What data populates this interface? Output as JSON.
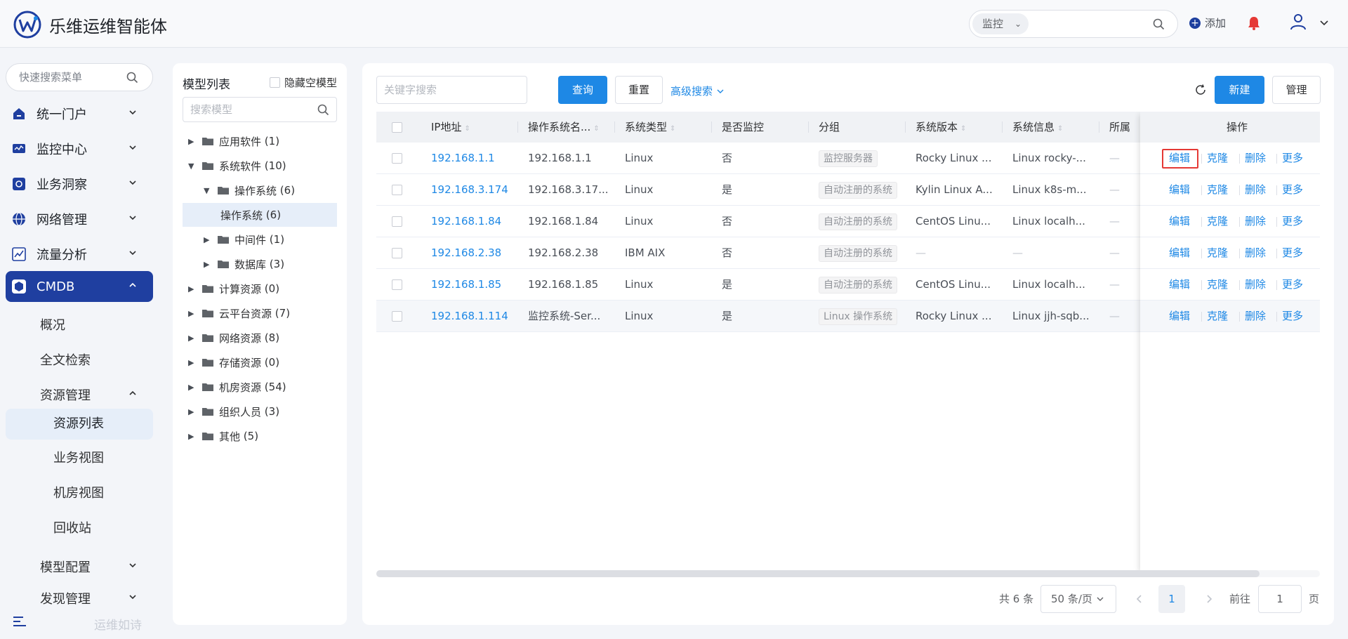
{
  "header": {
    "app_title": "乐维运维智能体",
    "search_scope": "监控",
    "add_label": "添加"
  },
  "nav": {
    "search_placeholder": "快速搜索菜单",
    "items": [
      {
        "label": "统一门户",
        "icon": "home-icon"
      },
      {
        "label": "监控中心",
        "icon": "monitor-icon"
      },
      {
        "label": "业务洞察",
        "icon": "insight-icon"
      },
      {
        "label": "网络管理",
        "icon": "globe-icon"
      },
      {
        "label": "流量分析",
        "icon": "chart-icon"
      },
      {
        "label": "CMDB",
        "icon": "cube-icon"
      }
    ],
    "cmdb_children": {
      "overview": "概况",
      "fulltext": "全文检索",
      "resource_mgmt": "资源管理",
      "resource_list": "资源列表",
      "business_view": "业务视图",
      "room_view": "机房视图",
      "recycle": "回收站",
      "model_config": "模型配置",
      "discovery": "发现管理"
    },
    "slogan": "运维如诗"
  },
  "model_tree": {
    "title": "模型列表",
    "hide_empty_label": "隐藏空模型",
    "search_placeholder": "搜索模型",
    "nodes": [
      {
        "label": "应用软件",
        "count": "(1)"
      },
      {
        "label": "系统软件",
        "count": "(10)"
      },
      {
        "label": "操作系统",
        "count": "(6)"
      },
      {
        "label": "操作系统",
        "count": "(6)"
      },
      {
        "label": "中间件",
        "count": "(1)"
      },
      {
        "label": "数据库",
        "count": "(3)"
      },
      {
        "label": "计算资源",
        "count": "(0)"
      },
      {
        "label": "云平台资源",
        "count": "(7)"
      },
      {
        "label": "网络资源",
        "count": "(8)"
      },
      {
        "label": "存储资源",
        "count": "(0)"
      },
      {
        "label": "机房资源",
        "count": "(54)"
      },
      {
        "label": "组织人员",
        "count": "(3)"
      },
      {
        "label": "其他",
        "count": "(5)"
      }
    ]
  },
  "toolbar": {
    "keyword_placeholder": "关键字搜索",
    "query": "查询",
    "reset": "重置",
    "advanced": "高级搜索",
    "new": "新建",
    "manage": "管理"
  },
  "table": {
    "columns": [
      "IP地址",
      "操作系统名...",
      "系统类型",
      "是否监控",
      "分组",
      "系统版本",
      "系统信息",
      "所属",
      "操作"
    ],
    "rows": [
      {
        "ip": "192.168.1.1",
        "os_name": "192.168.1.1",
        "type": "Linux",
        "monitored": "否",
        "group": "监控服务器",
        "version": "Rocky Linux ...",
        "info": "Linux rocky-...",
        "owner": "—"
      },
      {
        "ip": "192.168.3.174",
        "os_name": "192.168.3.17...",
        "type": "Linux",
        "monitored": "是",
        "group": "自动注册的系统",
        "version": "Kylin Linux A...",
        "info": "Linux k8s-m...",
        "owner": "—"
      },
      {
        "ip": "192.168.1.84",
        "os_name": "192.168.1.84",
        "type": "Linux",
        "monitored": "否",
        "group": "自动注册的系统",
        "version": "CentOS Linu...",
        "info": "Linux localh...",
        "owner": "—"
      },
      {
        "ip": "192.168.2.38",
        "os_name": "192.168.2.38",
        "type": "IBM AIX",
        "monitored": "否",
        "group": "自动注册的系统",
        "version": "—",
        "info": "—",
        "owner": "—"
      },
      {
        "ip": "192.168.1.85",
        "os_name": "192.168.1.85",
        "type": "Linux",
        "monitored": "是",
        "group": "自动注册的系统",
        "version": "CentOS Linu...",
        "info": "Linux localh...",
        "owner": "—"
      },
      {
        "ip": "192.168.1.114",
        "os_name": "监控系统-Ser...",
        "type": "Linux",
        "monitored": "是",
        "group": "Linux 操作系统",
        "version": "Rocky Linux ...",
        "info": "Linux jjh-sqb...",
        "owner": "—"
      }
    ],
    "actions": {
      "edit": "编辑",
      "clone": "克隆",
      "delete": "删除",
      "more": "更多"
    }
  },
  "pagination": {
    "total": "共 6 条",
    "page_size": "50 条/页",
    "current_page": "1",
    "goto_label": "前往",
    "goto_value": "1",
    "page_suffix": "页"
  },
  "colors": {
    "primary": "#1e88e5",
    "nav_active": "#1f3fa0",
    "highlight": "#e53935",
    "bell": "#e53935"
  }
}
